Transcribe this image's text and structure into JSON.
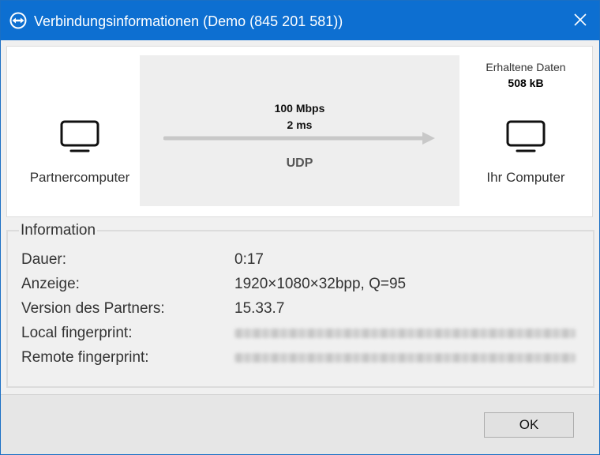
{
  "window": {
    "title": "Verbindungsinformationen (Demo (845 201 581))",
    "close_icon": "close-icon",
    "logo_icon": "teamviewer-logo-icon"
  },
  "connection": {
    "partner_label": "Partnercomputer",
    "own_label": "Ihr Computer",
    "received_label": "Erhaltene Daten",
    "received_value": "508 kB",
    "bandwidth": "100 Mbps",
    "latency": "2 ms",
    "protocol": "UDP"
  },
  "info": {
    "legend": "Information",
    "rows": [
      {
        "key": "Dauer:",
        "value": "0:17"
      },
      {
        "key": "Anzeige:",
        "value": "1920×1080×32bpp, Q=95"
      },
      {
        "key": "Version des Partners:",
        "value": "15.33.7"
      },
      {
        "key": "Local fingerprint:",
        "value": ""
      },
      {
        "key": "Remote fingerprint:",
        "value": ""
      }
    ]
  },
  "footer": {
    "ok_label": "OK"
  },
  "colors": {
    "titlebar": "#0d6fd1",
    "panel_bg": "#ffffff",
    "link_bg": "#eeeeee",
    "arrow": "#c8c8c8"
  }
}
